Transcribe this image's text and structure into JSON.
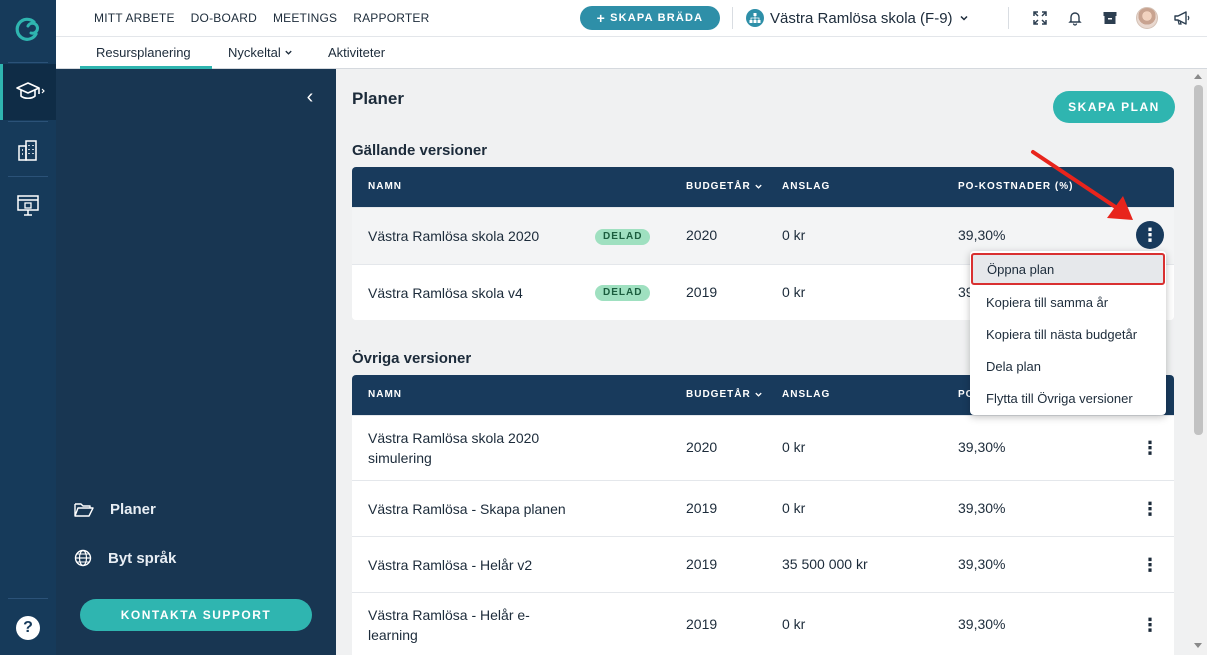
{
  "header": {
    "nav": [
      "MITT ARBETE",
      "DO-BOARD",
      "MEETINGS",
      "RAPPORTER"
    ],
    "create_board_label": "SKAPA BRÄDA",
    "org_name": "Västra Ramlösa skola (F-9)"
  },
  "subnav": {
    "tabs": [
      "Resursplanering",
      "Nyckeltal",
      "Aktiviteter"
    ],
    "active_tab": "Resursplanering"
  },
  "sidebar": {
    "links": [
      "Planer",
      "Byt språk"
    ],
    "support_label": "KONTAKTA SUPPORT"
  },
  "main": {
    "title": "Planer",
    "create_plan_label": "SKAPA PLAN",
    "current_section": "Gällande versioner",
    "other_section": "Övriga versioner",
    "columns": [
      "NAMN",
      "BUDGETÅR",
      "ANSLAG",
      "PO-KOSTNADER (%)"
    ],
    "columns_other": [
      "NAMN",
      "BUDGETÅR",
      "ANSLAG",
      "PO"
    ],
    "current_rows": [
      {
        "name": "Västra Ramlösa skola 2020",
        "badge": "DELAD",
        "year": "2020",
        "grant": "0 kr",
        "po": "39,30%"
      },
      {
        "name": "Västra Ramlösa skola v4",
        "badge": "DELAD",
        "year": "2019",
        "grant": "0 kr",
        "po": "39"
      }
    ],
    "other_rows": [
      {
        "name": "Västra Ramlösa skola 2020 simulering",
        "year": "2020",
        "grant": "0 kr",
        "po": "39,30%"
      },
      {
        "name": "Västra Ramlösa - Skapa planen",
        "year": "2019",
        "grant": "0 kr",
        "po": "39,30%"
      },
      {
        "name": "Västra Ramlösa - Helår v2",
        "year": "2019",
        "grant": "35 500 000 kr",
        "po": "39,30%"
      },
      {
        "name": "Västra Ramlösa - Helår e-learning",
        "year": "2019",
        "grant": "0 kr",
        "po": "39,30%"
      }
    ]
  },
  "context_menu": {
    "items": [
      "Öppna plan",
      "Kopiera till samma år",
      "Kopiera till nästa budgetår",
      "Dela plan",
      "Flytta till Övriga versioner"
    ],
    "highlighted": "Öppna plan"
  },
  "colors": {
    "accent": "#2fb5b0",
    "navy": "#183a5c",
    "annotation_red": "#e8241c"
  }
}
